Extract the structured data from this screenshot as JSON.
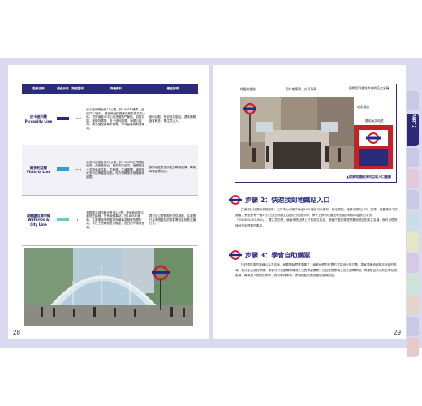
{
  "table": {
    "headers": [
      "路線名稱",
      "顏色示意",
      "跨越區域",
      "詳細資料",
      "備註說明"
    ],
    "rows": [
      {
        "name": "皮卡迪利線",
        "name_en": "Piccadilly Line",
        "color": "#1c2b8f",
        "zone": "1～6",
        "detail": "皮卡迪利線全長71公里，於1906年通車，全線共53個站，是倫敦地鐵路線中最為繁忙的一條，貫穿倫敦市中心的多個熱門景點，如柯芬園、萊斯特廣場、皮卡迪利圓環、海德公園角、騎士橋及南肯辛頓等，亦可直達希斯洛機場。",
        "note": "部份站點，例如柯芬園站，週末假期遊客較多，需注意出入。"
      },
      {
        "name": "維多利亞線",
        "name_en": "Victoria Line",
        "color": "#2a9fd8",
        "zone": "1～3",
        "detail": "維多利亞線全長21公里，於1968年正式開始使用，大致呈東北—西南方向走向，途經國王十字聖潘克拉斯、尤斯頓、牛津圓環、綠園及維多利亞等重要站點，可方便轉乘其他路線或國鐵。",
        "note": "部份站點會提供更多轉乘選擇，轉乘時需留意指示。"
      },
      {
        "name": "滑鐵盧及城市線",
        "name_en": "Waterloo & City Line",
        "color": "#6ec8c0",
        "zone": "1",
        "detail": "滑鐵盧及城市線全長僅2公里，是倫敦地鐵中最短的路線，只有兩個車站，於1898年通車，主要連接滑鐵盧站與倫敦金融城的銀行站，平日上班時間班次較密，週日則不開放營運。",
        "note": "週日及公眾假期不提供服務，往來銀行及滑鐵盧站的乘客需另覓其他交通方式。"
      }
    ]
  },
  "photo_right": {
    "labels": [
      "地鐵站標誌",
      "周待售車票、方可乘車",
      "國際認可標誌與站的英文名稱",
      "站名標誌",
      "路站英文站名"
    ],
    "caption": "▲倫敦地鐵維多利亞站入口圖解"
  },
  "step2": {
    "title": "步驟 2：快速找到地鐵站入口",
    "text": "在倫敦找地鐵站非常容易，在市中心內幾乎每走10分鐘就可以看到一個地鐵站。倫敦地鐵站入口一般是一個直通地下的通道，旁邊會有一個2公尺左右的鐵柱支起的白色指示牌，牌子上標有紅圈藍帶的圓形標誌和藍底白字的「UNDERGROUND」，要注意的是，倫敦地鐵站牌上只有英文站名，遊客只要記清楚想要地鐵站的英文名稱，就可以很快速地找到想要的車站。"
  },
  "step3": {
    "title": "步驟 3：學會自助購票",
    "text": "找好要搭乘的路線以及方向後，就要開始買票乘車了。倫敦地鐵的付費方式採用分區付費，乘客須通過起點站所處的區域，再決定合適的票價。乘客可於自動購票機或人工售票處購票。在自動售票機上首先選擇票種，再選取目的地所在車站或區域，最後投入相應的票款，即可取得車票，票價依起終點所處的區域而定。"
  },
  "page_numbers": {
    "left": "28",
    "right": "29"
  },
  "side_tab": {
    "text": "PART 2",
    "colors": [
      "#c9c9e6",
      "#2b2b7a",
      "#c9c9e6",
      "#e6c9d6",
      "#c9c9e6",
      "#c9dfe6",
      "#e6e6c9",
      "#d6c9e6",
      "#c9e6d6",
      "#e6d6c9",
      "#c9c9e6",
      "#e6c9c9"
    ]
  },
  "icons": [
    "underground-roundel-icon",
    "underground-roundel-icon"
  ]
}
